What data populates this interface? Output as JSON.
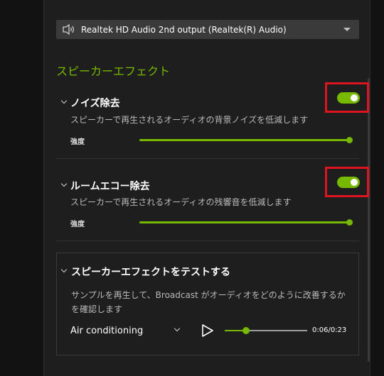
{
  "device": {
    "name": "Realtek HD Audio 2nd output (Realtek(R) Audio)",
    "icon": "speaker-icon"
  },
  "section": {
    "title": "スピーカーエフェクト"
  },
  "features": [
    {
      "title": "ノイズ除去",
      "description": "スピーカーで再生されるオーディオの背景ノイズを低減します",
      "strength_label": "強度",
      "strength_value": 1.0,
      "enabled": true
    },
    {
      "title": "ルームエコー除去",
      "description": "スピーカーで再生されるオーディオの残響音を低減します",
      "strength_label": "強度",
      "strength_value": 1.0,
      "enabled": true
    }
  ],
  "test": {
    "title": "スピーカーエフェクトをテストする",
    "description": "サンプルを再生して、Broadcast がオーディオをどのように改善するかを確認します",
    "sample": "Air conditioning",
    "time": "0:06/0:23",
    "progress": 0.26
  },
  "colors": {
    "accent": "#76b900",
    "highlight": "#e0141e"
  }
}
